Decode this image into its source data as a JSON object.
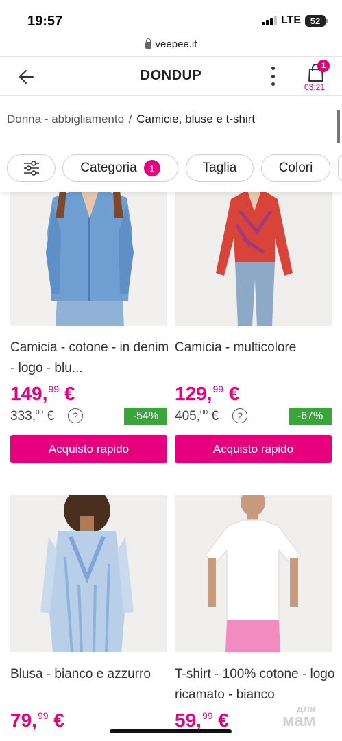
{
  "status_bar": {
    "time": "19:57",
    "network": "LTE",
    "battery": "52"
  },
  "browser": {
    "domain": "veepee.it"
  },
  "header": {
    "brand": "DONDUP",
    "cart_count": "1",
    "cart_timer": "03:21"
  },
  "breadcrumb": {
    "parent": "Donna - abbigliamento",
    "separator": "/",
    "current": "Camicie, bluse e t-shirt"
  },
  "filters": {
    "chips": [
      {
        "label": "Categoria",
        "badge": "1"
      },
      {
        "label": "Taglia"
      },
      {
        "label": "Colori"
      }
    ]
  },
  "products": [
    {
      "name": "Camicia - cotone - in denim - logo - blu...",
      "price_main": "149,",
      "price_cents": "99",
      "currency": "€",
      "old_main": "333,",
      "old_cents": "00",
      "old_currency": "€",
      "discount": "-54%",
      "button": "Acquisto rapido"
    },
    {
      "name": "Camicia - multicolore",
      "price_main": "129,",
      "price_cents": "99",
      "currency": "€",
      "old_main": "405,",
      "old_cents": "00",
      "old_currency": "€",
      "discount": "-67%",
      "button": "Acquisto rapido"
    },
    {
      "name": "Blusa - bianco e azzurro",
      "price_main": "79,",
      "price_cents": "99",
      "currency": "€"
    },
    {
      "name": "T-shirt - 100% cotone - logo ricamato - bianco",
      "price_main": "59,",
      "price_cents": "99",
      "currency": "€"
    }
  ],
  "watermark": {
    "line1": "для",
    "line2": "мам"
  },
  "colors": {
    "accent": "#e6007e",
    "discount": "#3aa53a"
  }
}
